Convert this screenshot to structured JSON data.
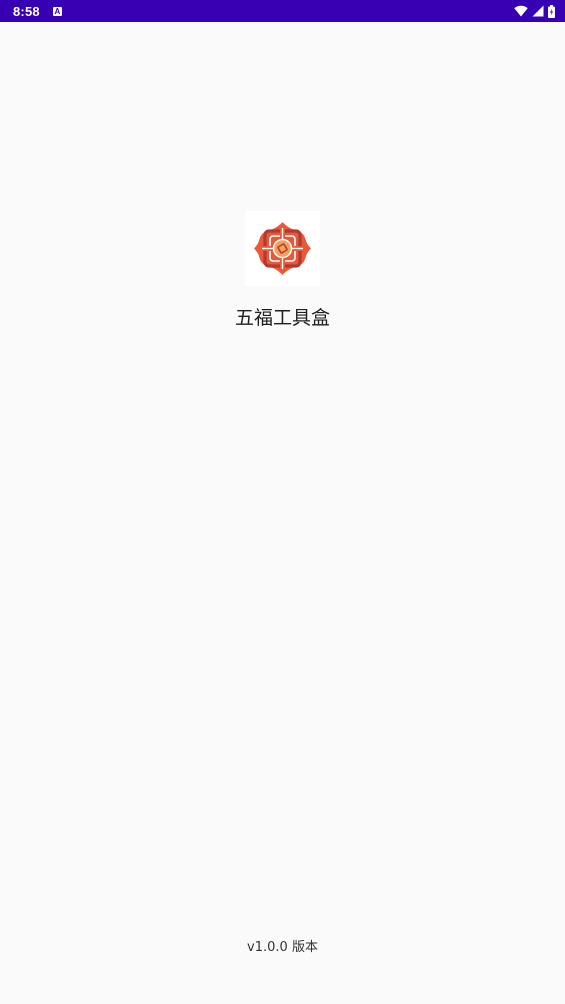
{
  "status_bar": {
    "time": "8:58",
    "notification_icon": "a-letter-icon",
    "icons": [
      "wifi-icon",
      "signal-icon",
      "battery-icon"
    ],
    "background_color": "#3700b3"
  },
  "splash": {
    "logo_icon": "five-blessings-logo-icon",
    "app_name": "五福工具盒",
    "version": "v1.0.0 版本",
    "background_color": "#fafafa",
    "logo_colors": [
      "#e8593a",
      "#b23a34",
      "#f4a15a"
    ]
  }
}
